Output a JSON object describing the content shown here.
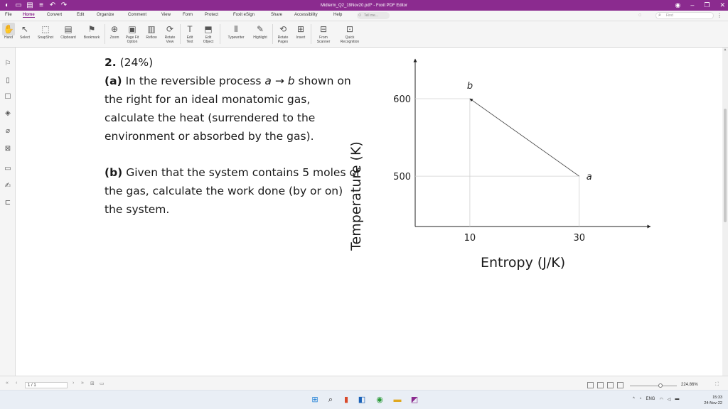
{
  "window": {
    "title": "Midterm_Q2_19Nov20.pdf* - Foxit PDF Editor",
    "accent_color": "#8b2b8f"
  },
  "menu": {
    "items": [
      "File",
      "Home",
      "Convert",
      "Edit",
      "Organize",
      "Comment",
      "View",
      "Form",
      "Protect",
      "Foxit eSign",
      "Share",
      "Accessibility",
      "Help"
    ],
    "active": "Home",
    "tell_me_placeholder": "Tell me...",
    "find_placeholder": "Find"
  },
  "ribbon": {
    "tools": [
      {
        "label": "Hand",
        "label2": "",
        "icon": "hand-icon"
      },
      {
        "label": "Select",
        "label2": "",
        "icon": "select-cursor-icon"
      },
      {
        "label": "SnapShot",
        "label2": "",
        "icon": "snapshot-icon"
      },
      {
        "label": "Clipboard",
        "label2": "",
        "icon": "clipboard-icon"
      },
      {
        "label": "Bookmark",
        "label2": "",
        "icon": "bookmark-icon"
      },
      {
        "label": "Zoom",
        "label2": "",
        "icon": "zoom-icon"
      },
      {
        "label": "Page Fit",
        "label2": "Option",
        "icon": "page-fit-icon"
      },
      {
        "label": "Reflow",
        "label2": "",
        "icon": "reflow-icon"
      },
      {
        "label": "Rotate",
        "label2": "View",
        "icon": "rotate-view-icon"
      },
      {
        "label": "Edit",
        "label2": "Text",
        "icon": "edit-text-icon"
      },
      {
        "label": "Edit",
        "label2": "Object",
        "icon": "edit-object-icon"
      },
      {
        "label": "Typewriter",
        "label2": "",
        "icon": "typewriter-icon"
      },
      {
        "label": "Highlight",
        "label2": "",
        "icon": "highlight-icon"
      },
      {
        "label": "Rotate",
        "label2": "Pages",
        "icon": "rotate-pages-icon"
      },
      {
        "label": "Insert",
        "label2": "",
        "icon": "insert-icon"
      },
      {
        "label": "From",
        "label2": "Scanner",
        "icon": "scanner-icon"
      },
      {
        "label": "Quick",
        "label2": "Recognition",
        "icon": "ocr-icon"
      }
    ]
  },
  "document": {
    "q_number": "2.",
    "q_weight": "(24%)",
    "part_a_tag": "(a)",
    "part_a_lines": [
      "In the reversible process ",
      "the right for an ideal monatomic gas,",
      "calculate the heat (surrendered to the",
      "environment or absorbed by the gas)."
    ],
    "part_a_a": "a",
    "part_a_arrow": "→",
    "part_a_b": "b",
    "part_a_tail": " shown on",
    "part_b_tag": "(b)",
    "part_b_lines": [
      " Given that the system contains 5 moles of",
      "the gas, calculate the work done (by or on)",
      "the system."
    ]
  },
  "chart_data": {
    "type": "line",
    "xlabel": "Entropy (J/K)",
    "ylabel": "Temperature (K)",
    "x_ticks": [
      10,
      30
    ],
    "y_ticks": [
      500,
      600
    ],
    "xlim": [
      0,
      42
    ],
    "ylim": [
      435,
      655
    ],
    "series": [
      {
        "points": [
          {
            "x": 30,
            "y": 500,
            "label": "a"
          },
          {
            "x": 10,
            "y": 600,
            "label": "b"
          }
        ]
      }
    ],
    "guide_lines": true
  },
  "status": {
    "page_indicator": "1 / 1",
    "zoom": "224.86%"
  },
  "taskbar": {
    "language": "ENG",
    "time": "15:33",
    "date": "24-Nov-22"
  }
}
